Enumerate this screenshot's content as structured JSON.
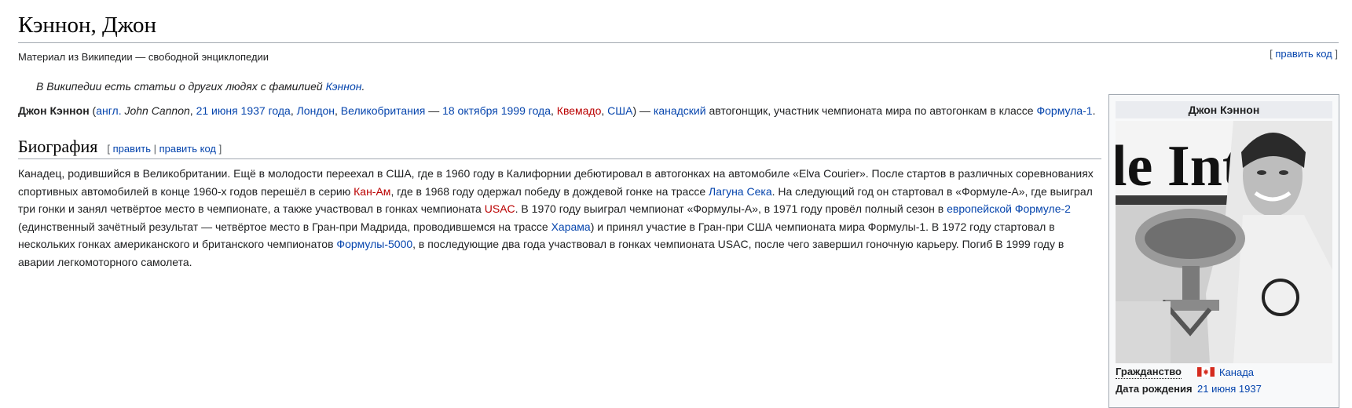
{
  "article": {
    "title": "Кэннон, Джон",
    "site_sub": "Материал из Википедии — свободной энциклопедии",
    "edit_code": "править код"
  },
  "hatnote": {
    "text": "В Википедии есть статьи о других людях с фамилией ",
    "link": "Кэннон",
    "end": "."
  },
  "lead": {
    "name": "Джон Кэннон",
    "open": " (",
    "lang": "англ.",
    "orig_name": " John Cannon",
    "comma1": ", ",
    "birth_date": "21 июня 1937 года",
    "comma2": ", ",
    "birth_city": "Лондон",
    "comma3": ", ",
    "birth_country": "Великобритания",
    "dash": " — ",
    "death_date": "18 октября 1999 года",
    "comma4": ", ",
    "death_place": "Квемадо",
    "comma5": ", ",
    "death_country": "США",
    "close": ") — ",
    "nationality": "канадский",
    "rest": " автогонщик, участник чемпионата мира по автогонкам в классе ",
    "f1": "Формула-1",
    "end": "."
  },
  "biography": {
    "heading": "Биография",
    "edit": "править",
    "sep": "|",
    "edit_code": "править код",
    "t1": "Канадец, родившийся в Великобритании. Ещё в молодости переехал в США, где в 1960 году в Калифорнии дебютировал в автогонках на автомобиле «Elva Courier». После стартов в различных соревнованиях спортивных автомобилей в конце 1960-х годов перешёл в серию ",
    "l_canam": "Кан-Ам",
    "t2": ", где в 1968 году одержал победу в дождевой гонке на трассе ",
    "l_laguna": "Лагуна Сека",
    "t3": ". На следующий год он стартовал в «Формуле-А», где выиграл три гонки и занял четвёртое место в чемпионате, а также участвовал в гонках чемпионата ",
    "l_usac": "USAC",
    "t4": ". В 1970 году выиграл чемпионат «Формулы-А», в 1971 году провёл полный сезон в ",
    "l_euro_f2": "европейской Формуле-2",
    "t5": " (единственный зачётный результат — четвёртое место в Гран-при Мадрида, проводившемся на трассе ",
    "l_jarama": "Харама",
    "t6": ") и принял участие в Гран-при США чемпионата мира Формулы-1. В 1972 году стартовал в нескольких гонках американского и британского чемпионатов ",
    "l_f5000": "Формулы-5000",
    "t7": ", в последующие два года участвовал в гонках чемпионата USAC, после чего завершил гоночную карьеру. Погиб В 1999 году в аварии легкомоторного самолета."
  },
  "infobox": {
    "caption": "Джон Кэннон",
    "photo_banner_text": "le Int",
    "rows": [
      {
        "label": "Гражданство",
        "value": "Канада",
        "flag": "canada-flag-icon"
      },
      {
        "label": "Дата рождения",
        "value": "21 июня 1937"
      }
    ]
  },
  "colors": {
    "link": "#0645ad",
    "redlink": "#ba0000",
    "text": "#202122",
    "rule": "#a2a9b1",
    "infobox_bg": "#f8f9fa"
  }
}
